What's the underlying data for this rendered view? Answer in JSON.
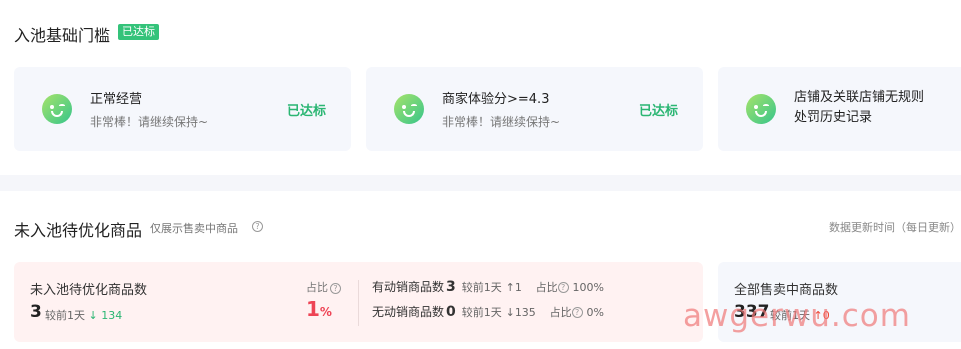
{
  "section1": {
    "title": "入池基础门槛",
    "badge": "已达标",
    "cards": [
      {
        "title": "正常经营",
        "subtitle": "非常棒！请继续保持~",
        "status": "已达标"
      },
      {
        "title": "商家体验分>=4.3",
        "subtitle": "非常棒！请继续保持~",
        "status": "已达标"
      },
      {
        "title_line1": "店铺及关联店铺无规则",
        "title_line2": "处罚历史记录"
      }
    ]
  },
  "section2": {
    "title": "未入池待优化商品",
    "note": "仅展示售卖中商品",
    "update_time": "数据更新时间（每日更新）",
    "pending": {
      "label": "未入池待优化商品数",
      "count": "3",
      "compare_label": "较前1天",
      "compare_arrow": "↓",
      "compare_value": "134",
      "ratio_label": "占比",
      "ratio_value": "1",
      "ratio_unit": "%"
    },
    "active": {
      "label": "有动销商品数",
      "count": "3",
      "compare_label": "较前1天",
      "compare_arrow": "↑",
      "compare_value": "1",
      "ratio_label": "占比",
      "ratio_value": "100%"
    },
    "inactive": {
      "label": "无动销商品数",
      "count": "0",
      "compare_label": "较前1天",
      "compare_arrow": "↓",
      "compare_value": "135",
      "ratio_label": "占比",
      "ratio_value": "0%"
    },
    "all_on_sale": {
      "label": "全部售卖中商品数",
      "count": "337",
      "compare_label": "较前1天",
      "compare_arrow": "↑",
      "compare_value": "0"
    }
  },
  "watermark": "awgerwu.com",
  "colors": {
    "success": "#2bb673",
    "danger": "#ee4455",
    "badge_bg": "#34c37a"
  }
}
